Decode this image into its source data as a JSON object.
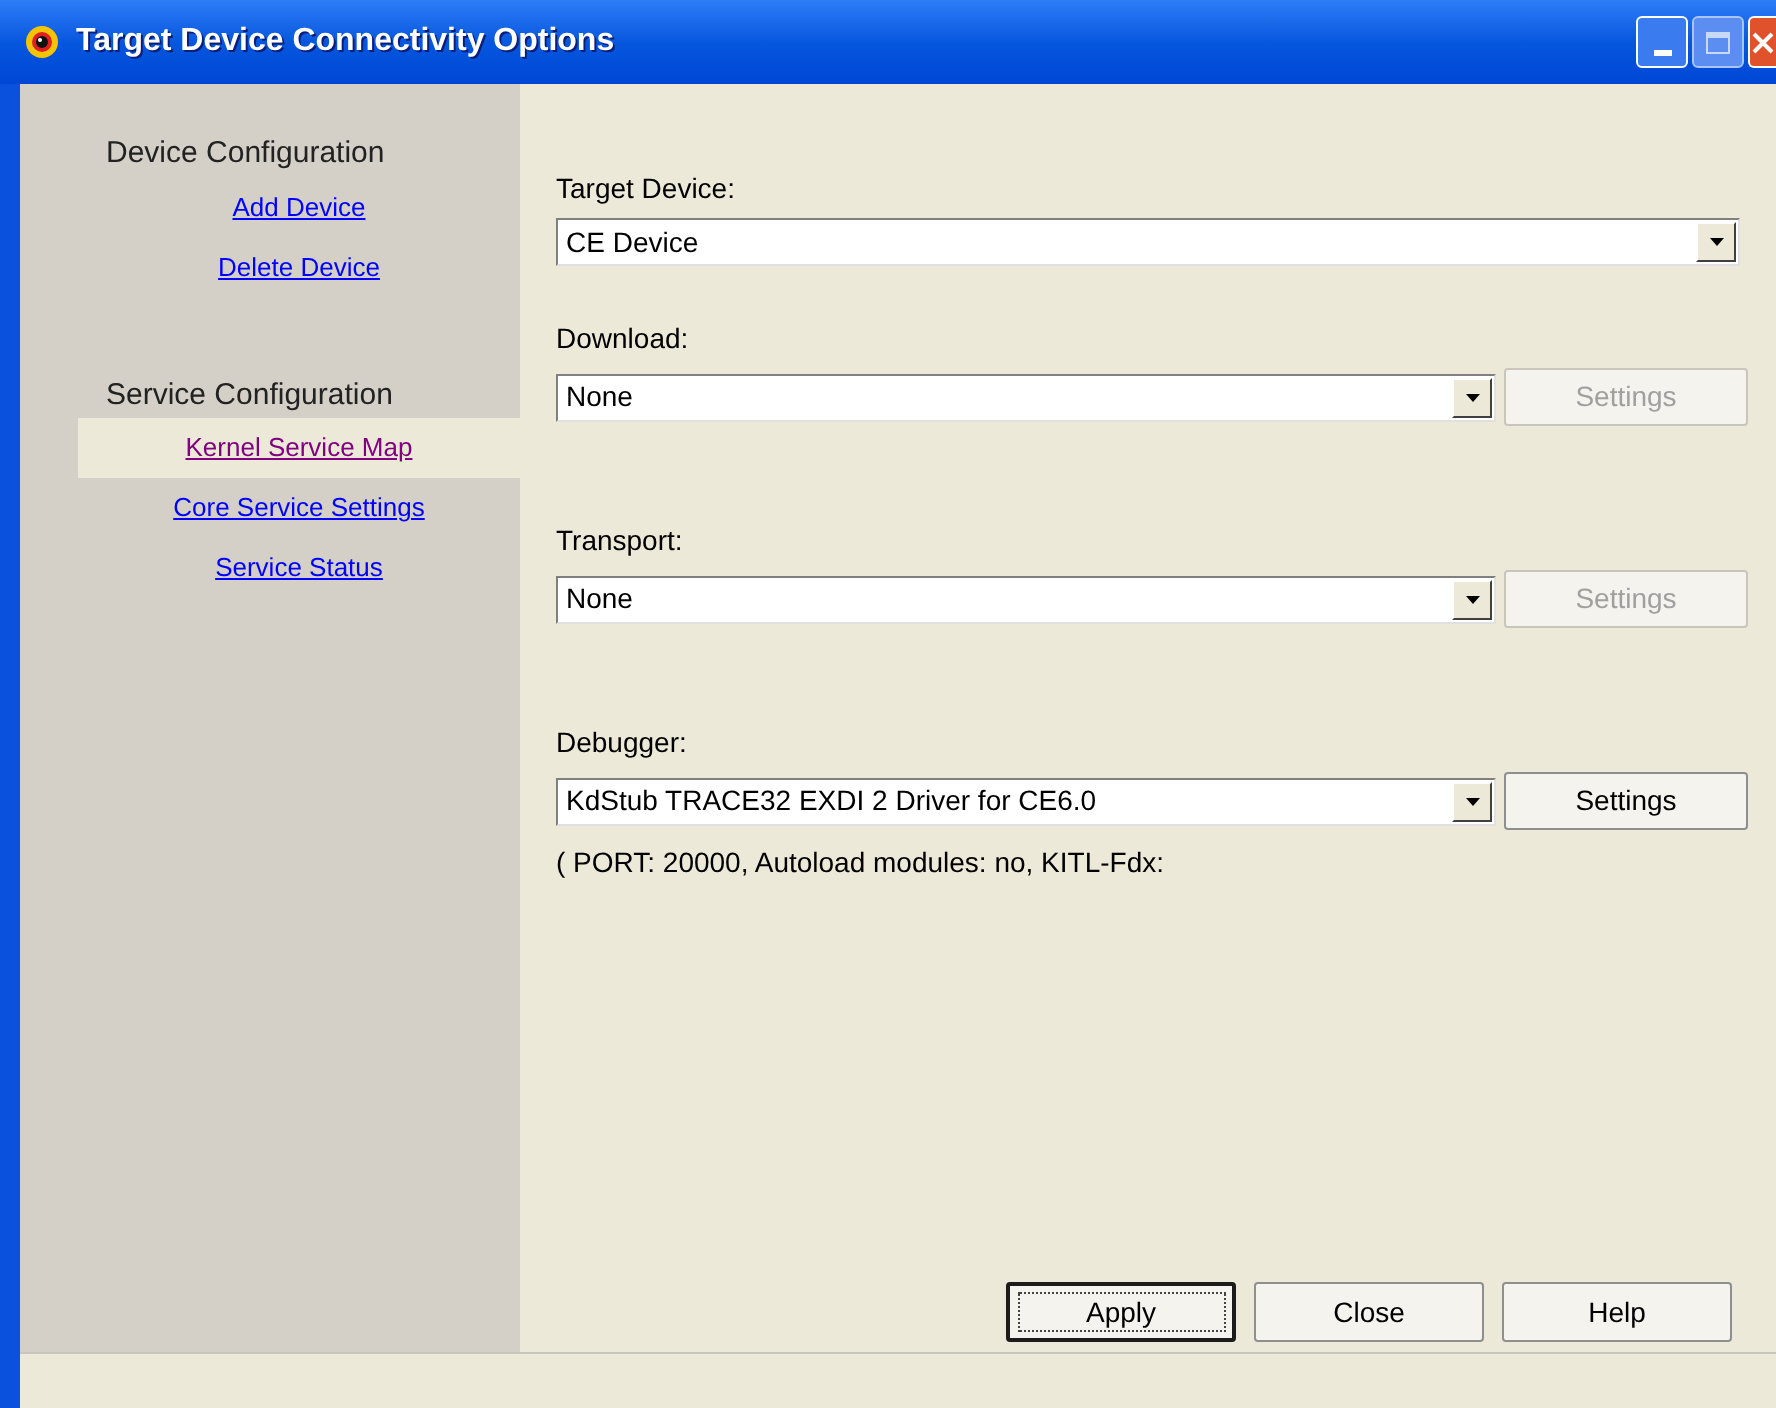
{
  "window": {
    "title": "Target Device Connectivity Options"
  },
  "sidebar": {
    "groups": [
      {
        "heading": "Device Configuration",
        "items": [
          {
            "label": "Add Device",
            "selected": false
          },
          {
            "label": "Delete Device",
            "selected": false
          }
        ]
      },
      {
        "heading": "Service Configuration",
        "items": [
          {
            "label": "Kernel Service Map",
            "selected": true
          },
          {
            "label": "Core Service Settings",
            "selected": false
          },
          {
            "label": "Service Status",
            "selected": false
          }
        ]
      }
    ]
  },
  "fields": [
    {
      "label": "Target Device:",
      "value": "CE Device"
    },
    {
      "label": "Download:",
      "value": "None",
      "settings": {
        "label": "Settings",
        "disabled": true
      }
    },
    {
      "label": "Transport:",
      "value": "None",
      "settings": {
        "label": "Settings",
        "disabled": true
      }
    },
    {
      "label": "Debugger:",
      "value": "KdStub TRACE32 EXDI 2 Driver for CE6.0",
      "settings": {
        "label": "Settings",
        "disabled": false
      },
      "info": "( PORT: 20000, Autoload modules: no, KITL-Fdx:"
    }
  ],
  "buttons": [
    {
      "label": "Apply",
      "default": true
    },
    {
      "label": "Close",
      "default": false
    },
    {
      "label": "Help",
      "default": false
    }
  ]
}
